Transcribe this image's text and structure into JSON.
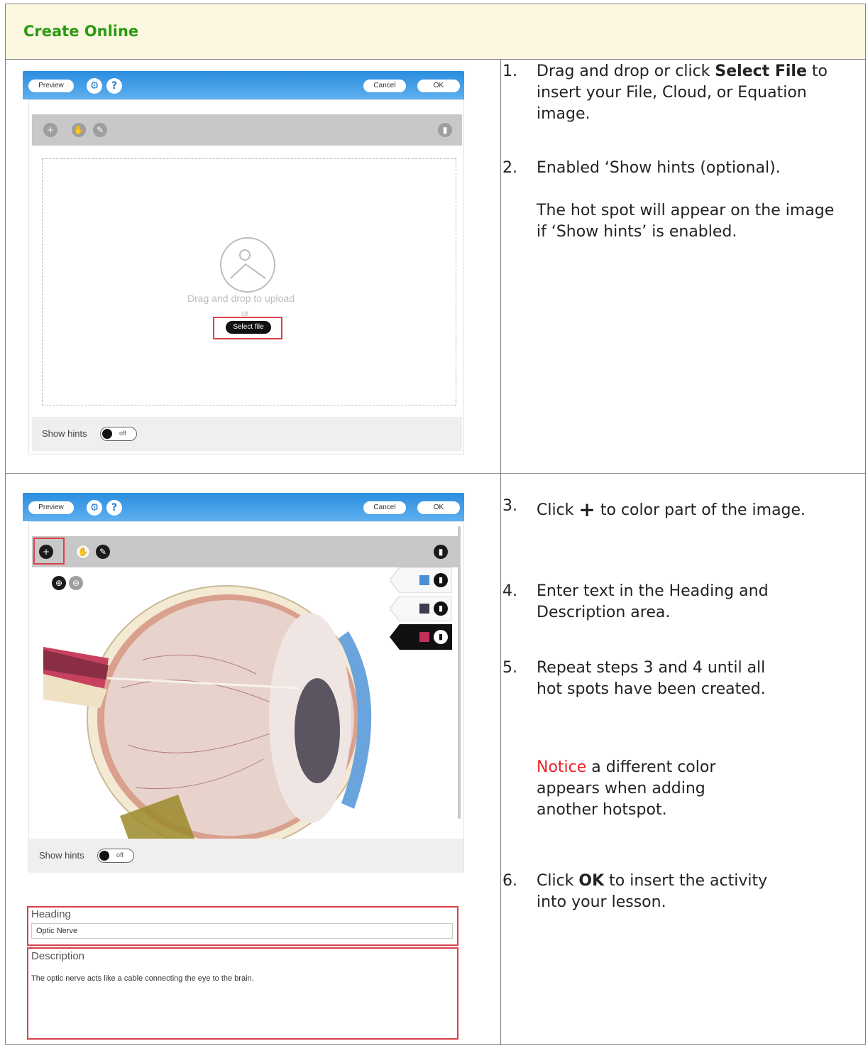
{
  "header": {
    "title": "Create Online"
  },
  "editor": {
    "preview_label": "Preview",
    "settings_icon": "gear-icon",
    "help_label": "?",
    "cancel_label": "Cancel",
    "ok_label": "OK",
    "show_hints_label": "Show hints",
    "toggle_state": "off"
  },
  "upload_panel": {
    "drop_text": "Drag and drop to upload",
    "or_text": "or",
    "select_label": "Select file"
  },
  "hotspot_panel": {
    "swatches": [
      {
        "color": "#4a90d9"
      },
      {
        "color": "#3f3a4d"
      },
      {
        "color": "#c2305a",
        "active": true
      }
    ],
    "heading_label": "Heading",
    "heading_value": "Optic Nerve",
    "description_label": "Description",
    "description_value": "The optic nerve acts like a cable connecting the eye to the brain."
  },
  "steps": {
    "s1_num": "1.",
    "s1_a": "Drag and drop or click ",
    "s1_b": "Select File",
    "s1_c": " to insert your File, Cloud, or Equation image.",
    "s2_num": "2.",
    "s2_a": "Enabled ‘Show hints (optional).",
    "s2_b": "The hot spot will appear on the image if ‘Show hints’ is enabled.",
    "s3_num": "3.",
    "s3_a": "Click ",
    "s3_plus": "+",
    "s3_b": " to color part of the image.",
    "s4_num": "4.",
    "s4_a": "Enter text in the Heading and Description area.",
    "s5_num": "5.",
    "s5_a": "Repeat steps 3 and 4 until all hot spots have been created.",
    "s5_notice": "Notice",
    "s5_b": " a different color appears when adding another hotspot.",
    "s6_num": "6.",
    "s6_a": "Click ",
    "s6_b": "OK",
    "s6_c": " to insert the activity into your lesson."
  }
}
